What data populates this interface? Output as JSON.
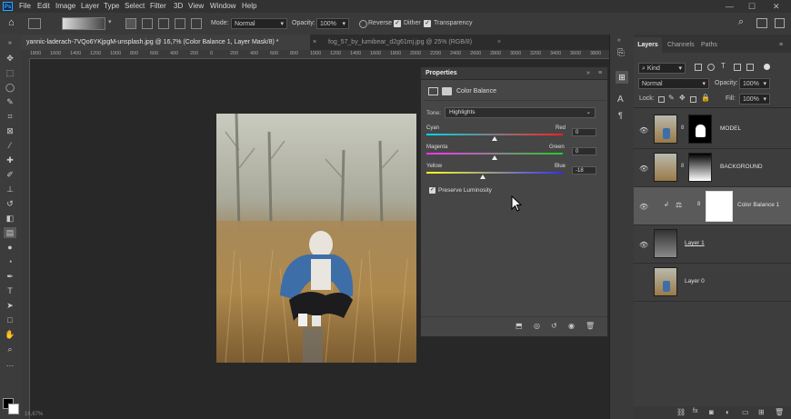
{
  "app": {
    "logo": "Ps"
  },
  "menu": [
    "File",
    "Edit",
    "Image",
    "Layer",
    "Type",
    "Select",
    "Filter",
    "3D",
    "View",
    "Window",
    "Help"
  ],
  "window_controls": {
    "minimize": "—",
    "maximize": "☐",
    "close": "✕"
  },
  "options_bar": {
    "mode_label": "Mode:",
    "mode_value": "Normal",
    "opacity_label": "Opacity:",
    "opacity_value": "100%",
    "reverse_label": "Reverse",
    "dither_label": "Dither",
    "transparency_label": "Transparency"
  },
  "tabs": [
    {
      "label": "yannic-laderach-7VQo6YKjpgM-unsplash.jpg @ 16,7% (Color Balance 1, Layer Mask/8) *",
      "active": true
    },
    {
      "label": "fog_57_by_lumibear_d2g61mj.jpg @ 25% (RGB/8)",
      "active": false
    }
  ],
  "ruler_ticks": [
    "1800",
    "1600",
    "1400",
    "1200",
    "1000",
    "800",
    "600",
    "400",
    "200",
    "0",
    "200",
    "400",
    "600",
    "800",
    "1000",
    "1200",
    "1400",
    "1600",
    "1800",
    "2000",
    "2200",
    "2400",
    "2600",
    "2800",
    "3000",
    "3200",
    "3400",
    "3600",
    "3800",
    "4000",
    "4200",
    "4400",
    "4600",
    "4800",
    "5000",
    "5200",
    "5400",
    "5600",
    "5800",
    "6000",
    "6200",
    "6400"
  ],
  "properties": {
    "title": "Properties",
    "adjustment_name": "Color Balance",
    "tone_label": "Tone:",
    "tone_value": "Highlights",
    "sliders": [
      {
        "left": "Cyan",
        "right": "Red",
        "value": "0",
        "position": 0.5
      },
      {
        "left": "Magenta",
        "right": "Green",
        "value": "0",
        "position": 0.5
      },
      {
        "left": "Yellow",
        "right": "Blue",
        "value": "-18",
        "position": 0.41
      }
    ],
    "preserve_luminosity_label": "Preserve Luminosity",
    "preserve_luminosity_checked": true
  },
  "layers_panel": {
    "tabs": [
      "Layers",
      "Channels",
      "Paths"
    ],
    "filter_kind": "Kind",
    "blend_mode": "Normal",
    "opacity_label": "Opacity:",
    "opacity_value": "100%",
    "lock_label": "Lock:",
    "fill_label": "Fill:",
    "fill_value": "100%",
    "layers": [
      {
        "name": "MODEL",
        "visible": true,
        "selected": false
      },
      {
        "name": "BACKGROUND",
        "visible": true,
        "selected": false
      },
      {
        "name": "Color Balance 1",
        "visible": true,
        "selected": true
      },
      {
        "name": "Layer 1",
        "visible": true,
        "selected": false
      },
      {
        "name": "Layer 0",
        "visible": false,
        "selected": false
      }
    ]
  },
  "status_bar": {
    "text": "16,67%"
  },
  "colors": {
    "accent": "#31a8ff",
    "ui_dark": "#282828",
    "panel": "#464646",
    "selected_layer": "#5a5a5a"
  }
}
